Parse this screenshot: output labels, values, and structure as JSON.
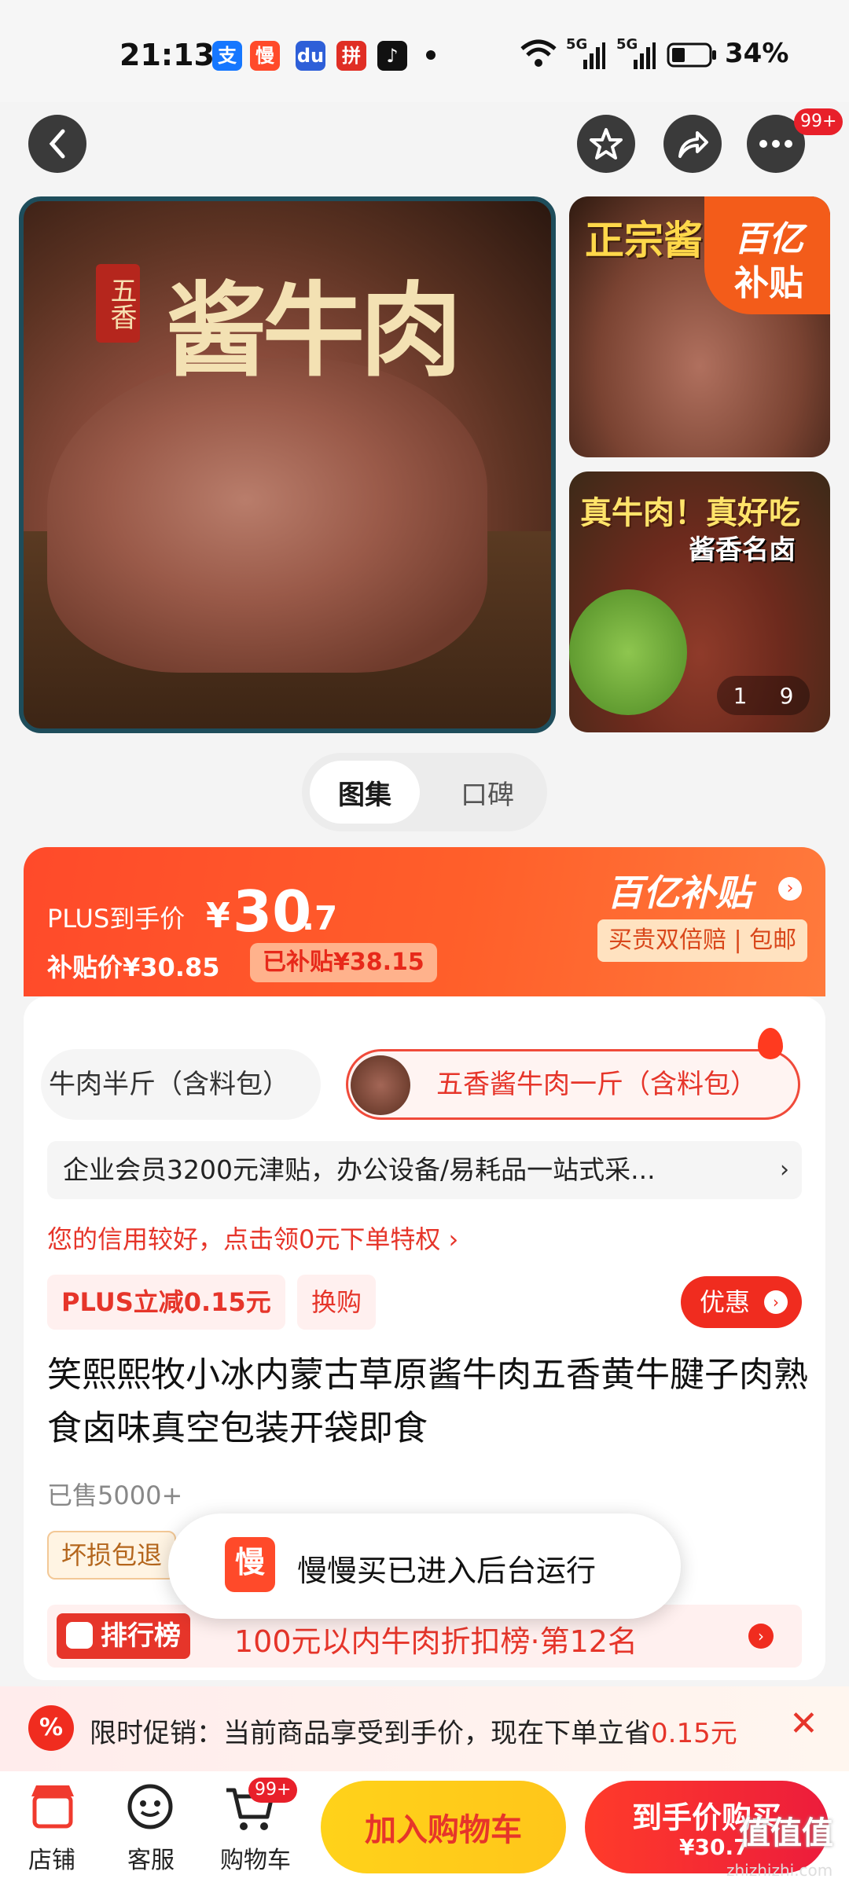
{
  "status_bar": {
    "time": "21:13",
    "network1": "5G",
    "network2": "5G",
    "battery": "34%"
  },
  "top_controls": {
    "badge": "99+"
  },
  "gallery": {
    "main_tag": "五香",
    "main_title": "酱牛肉",
    "thumb1_title": "正宗酱",
    "thumb1_corner_line1": "百亿",
    "thumb1_corner_line2": "补贴",
    "thumb2_line1": "真牛肉！真好吃",
    "thumb2_line2": "酱香名卤",
    "pager_current": "1",
    "pager_total": "9"
  },
  "tabs": {
    "gallery": "图集",
    "reviews": "口碑"
  },
  "price_card": {
    "plus_label": "PLUS到手价",
    "currency": "¥",
    "price_int": "30",
    "price_dec": ".7",
    "subsidy_label": "补贴价¥30.85",
    "subsidy_badge": "已补贴¥38.15",
    "brand": "百亿补贴",
    "guarantee": "买贵双倍赔 | 包邮"
  },
  "specs": {
    "option1": "牛肉半斤（含料包）",
    "option2": "五香酱牛肉一斤（含料包）"
  },
  "enterprise_banner": "企业会员3200元津贴，办公设备/易耗品一站式采...",
  "credit_text": "您的信用较好，点击领0元下单特权 ›",
  "chips": {
    "plus_discount": "PLUS立减0.15元",
    "exchange": "换购",
    "coupon": "优惠"
  },
  "product": {
    "title": "笑熙熙牧小冰内蒙古草原酱牛肉五香黄牛腱子肉熟食卤味真空包装开袋即食",
    "sold": "已售5000+",
    "damage_tag": "坏损包退"
  },
  "rank": {
    "tag": "排行榜",
    "text": "100元以内牛肉折扣榜·第12名"
  },
  "toast": {
    "logo": "慢",
    "text": "慢慢买已进入后台运行"
  },
  "promo": {
    "icon": "%",
    "text": "限时促销：当前商品享受到手价，现在下单立省",
    "amount": "0.15元",
    "close": "✕"
  },
  "bottom_bar": {
    "shop": "店铺",
    "service": "客服",
    "cart": "购物车",
    "cart_badge": "99+",
    "add_cart": "加入购物车",
    "buy_line1": "到手价购买",
    "buy_line2": "¥30.7"
  },
  "watermark": {
    "main": "值值值",
    "sub": "zhizhizhi.com"
  }
}
